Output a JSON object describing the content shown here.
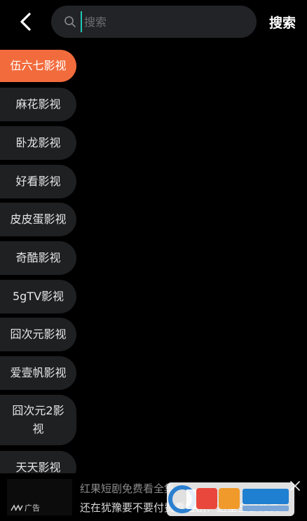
{
  "header": {
    "search_placeholder": "搜索",
    "search_button_label": "搜索"
  },
  "sources": [
    {
      "label": "伍六七影视",
      "active": true
    },
    {
      "label": "麻花影视"
    },
    {
      "label": "卧龙影视"
    },
    {
      "label": "好看影视"
    },
    {
      "label": "皮皮蛋影视"
    },
    {
      "label": "奇酷影视"
    },
    {
      "label": "5gTV影视"
    },
    {
      "label": "囧次元影视"
    },
    {
      "label": "爱壹帆影视"
    },
    {
      "label": "囧次元2影视"
    },
    {
      "label": "天天影视"
    }
  ],
  "ad": {
    "tag": "广告",
    "title": "红果短剧免费看全集",
    "description": "还在犹豫要不要付费看短剧？这里全部免费"
  },
  "colors": {
    "background": "#000000",
    "active_accent": "#f26b3c",
    "item_background": "#1f2022",
    "search_background": "#222326",
    "cursor": "#1fc7b5"
  }
}
